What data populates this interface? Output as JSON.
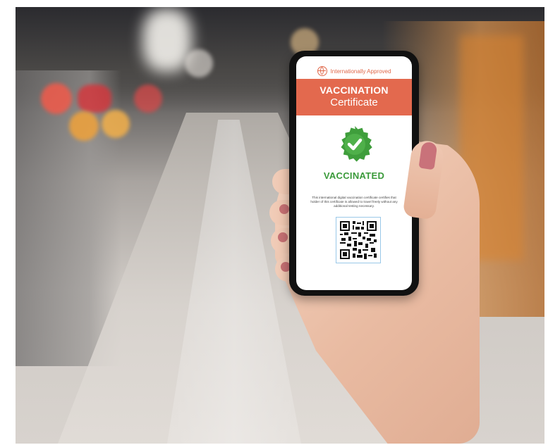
{
  "certificate": {
    "approved_label": "Internationally Approved",
    "title_line1": "VACCINATION",
    "title_line2": "Certificate",
    "status": "VACCINATED",
    "description": "This international digital vaccination certificate certifies that holder of this certificate is allowed to travel freely without any additional testing necessary."
  },
  "colors": {
    "banner": "#e3694e",
    "accent_orange": "#e0684a",
    "status_green": "#3a9a3a"
  },
  "icons": {
    "header": "globe-icon",
    "status": "checkmark-seal-icon",
    "code": "qr-code-icon"
  }
}
